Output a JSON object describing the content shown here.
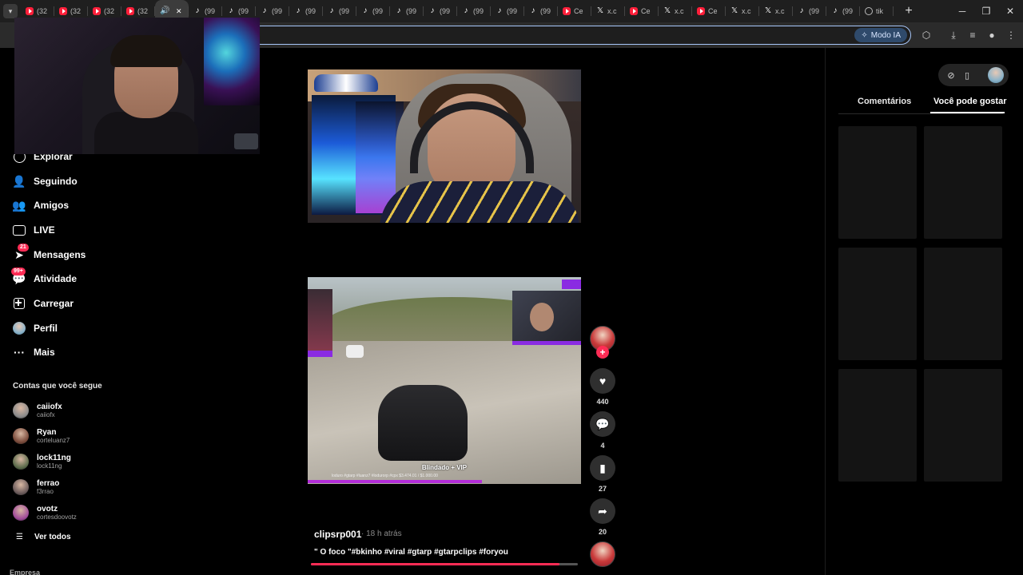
{
  "browser": {
    "tabs": [
      {
        "icon": "youtube-icon",
        "label": "(32"
      },
      {
        "icon": "youtube-icon",
        "label": "(32"
      },
      {
        "icon": "youtube-icon",
        "label": "(32"
      },
      {
        "icon": "youtube-icon",
        "label": "(32"
      },
      {
        "icon": "speaker-icon",
        "label": "",
        "active": true
      },
      {
        "icon": "tiktok-icon",
        "label": "(99"
      },
      {
        "icon": "tiktok-icon",
        "label": "(99"
      },
      {
        "icon": "tiktok-icon",
        "label": "(99"
      },
      {
        "icon": "tiktok-icon",
        "label": "(99"
      },
      {
        "icon": "tiktok-icon",
        "label": "(99"
      },
      {
        "icon": "tiktok-icon",
        "label": "(99"
      },
      {
        "icon": "tiktok-icon",
        "label": "(99"
      },
      {
        "icon": "tiktok-icon",
        "label": "(99"
      },
      {
        "icon": "tiktok-icon",
        "label": "(99"
      },
      {
        "icon": "tiktok-icon",
        "label": "(99"
      },
      {
        "icon": "tiktok-icon",
        "label": "(99"
      },
      {
        "icon": "youtube-icon",
        "label": "Ce"
      },
      {
        "icon": "x-icon",
        "label": "x.c"
      },
      {
        "icon": "youtube-icon",
        "label": "Ce"
      },
      {
        "icon": "x-icon",
        "label": "x.c"
      },
      {
        "icon": "youtube-icon",
        "label": "Ce"
      },
      {
        "icon": "x-icon",
        "label": "x.c"
      },
      {
        "icon": "x-icon",
        "label": "x.c"
      },
      {
        "icon": "tiktok-icon",
        "label": "(99"
      },
      {
        "icon": "tiktok-icon",
        "label": "(99"
      },
      {
        "icon": "globe-icon",
        "label": "tik"
      }
    ],
    "ai_mode_label": "Modo IA"
  },
  "nav": {
    "items": [
      {
        "name": "explore",
        "label": "Explorar",
        "icon": "compass-icon"
      },
      {
        "name": "following",
        "label": "Seguindo",
        "icon": "person-icon"
      },
      {
        "name": "friends",
        "label": "Amigos",
        "icon": "people-icon"
      },
      {
        "name": "live",
        "label": "LIVE",
        "icon": "tv-icon"
      },
      {
        "name": "messages",
        "label": "Mensagens",
        "icon": "paper-plane-icon",
        "badge": "21"
      },
      {
        "name": "activity",
        "label": "Atividade",
        "icon": "chat-icon",
        "badge": "99+"
      },
      {
        "name": "upload",
        "label": "Carregar",
        "icon": "plus-box-icon"
      },
      {
        "name": "profile",
        "label": "Perfil",
        "icon": "avatar-icon"
      },
      {
        "name": "more",
        "label": "Mais",
        "icon": "ellipsis-icon"
      }
    ],
    "following_title": "Contas que você segue",
    "following": [
      {
        "name": "caiiofx",
        "handle": "caiiofx",
        "color": "#8a8a8a"
      },
      {
        "name": "Ryan",
        "handle": "corteluanz7",
        "color": "#7a4a3a"
      },
      {
        "name": "lock11ng",
        "handle": "lock11ng",
        "color": "#5a6a4a"
      },
      {
        "name": "ferrao",
        "handle": "f3rrao",
        "color": "#6a5a5a"
      },
      {
        "name": "ovotz",
        "handle": "cortesdoovotz",
        "color": "#a04a9a"
      }
    ],
    "see_all": "Ver todos",
    "footer": "Empresa"
  },
  "post": {
    "author": "clipsrp001",
    "time": "· 18 h atrás",
    "description": "\" O foco \"#bkinho #viral #gtarp #gtarpclips #foryou",
    "video_caption": "Blindado + VIP",
    "video_ticker": "loduro #gtarp #luanz7 #lodurorp #cpx     $3.474.01 / $1.000.00",
    "progress": 0.93,
    "likes": "440",
    "comments": "4",
    "saves": "27",
    "shares": "20"
  },
  "right_panel": {
    "tabs": [
      "Comentários",
      "Você pode gostar"
    ],
    "active_tab": 1
  },
  "colors": {
    "accent": "#fe2c55",
    "background": "#000000"
  }
}
